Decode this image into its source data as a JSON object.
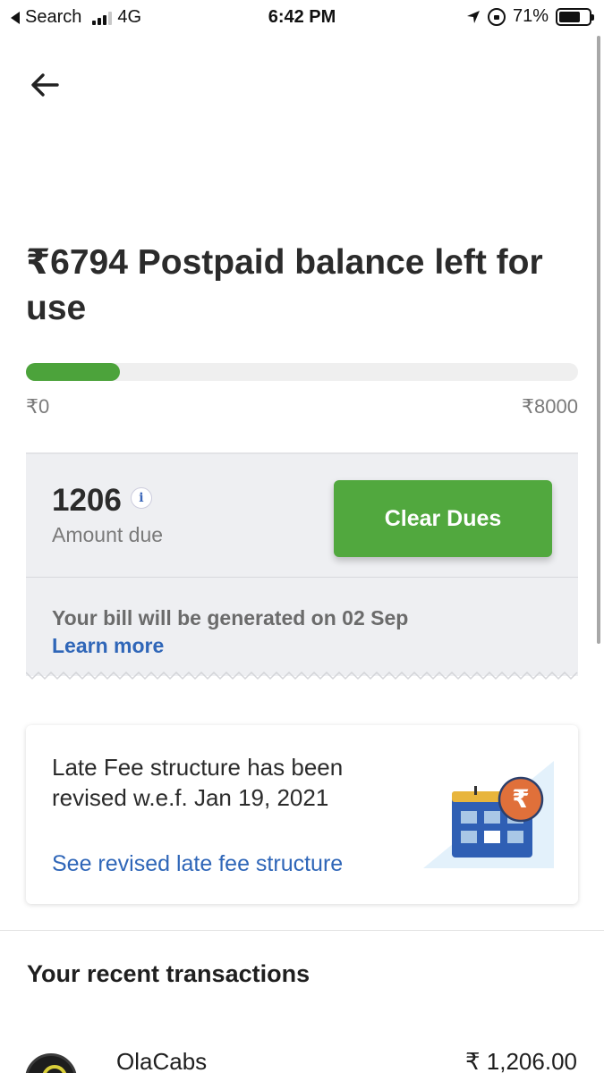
{
  "status_bar": {
    "back_app": "Search",
    "network": "4G",
    "time": "6:42 PM",
    "battery": "71%",
    "battery_level": 0.71
  },
  "balance": {
    "headline": "₹6794 Postpaid balance left for use",
    "progress_fraction": 0.17,
    "min_label": "₹0",
    "max_label": "₹8000",
    "fill_color": "#4ca33b"
  },
  "due": {
    "amount": "1206",
    "info_icon": "i",
    "label": "Amount due",
    "button_label": "Clear Dues",
    "bill_text": "Your bill will be generated on 02 Sep",
    "learn_more": "Learn more",
    "button_color": "#51a83e"
  },
  "late_fee": {
    "title": "Late Fee structure has been revised w.e.f. Jan 19, 2021",
    "link": "See revised late fee structure",
    "rupee_symbol": "₹"
  },
  "transactions": {
    "title": "Your recent transactions",
    "items": [
      {
        "name": "OlaCabs",
        "amount": "₹ 1,206.00"
      }
    ]
  }
}
